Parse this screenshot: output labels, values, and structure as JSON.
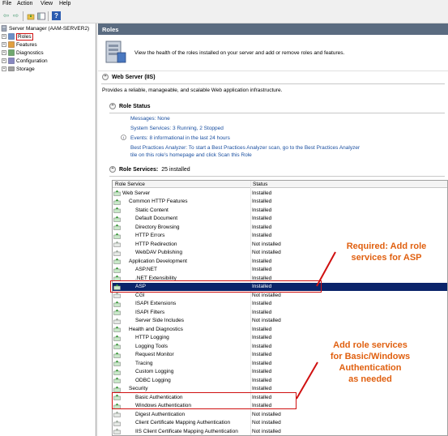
{
  "menu": {
    "file": "File",
    "action": "Action",
    "view": "View",
    "help": "Help"
  },
  "toolbar": {
    "back_glyph": "⇦",
    "forward_glyph": "⇨",
    "help_glyph": "?"
  },
  "tree": {
    "root": "Server Manager (AAM-SERVER2)",
    "items": [
      {
        "label": "Roles"
      },
      {
        "label": "Features"
      },
      {
        "label": "Diagnostics"
      },
      {
        "label": "Configuration"
      },
      {
        "label": "Storage"
      }
    ]
  },
  "panel": {
    "title": "Roles",
    "description": "View the health of the roles installed on your server and add or remove roles and features."
  },
  "web_server": {
    "header": "Web Server (IIS)",
    "description": "Provides a reliable, manageable, and scalable Web application infrastructure.",
    "role_status": {
      "header": "Role Status",
      "messages": "Messages: None",
      "system_services": "System Services: 3 Running, 2 Stopped",
      "events": "Events: 8 informational in the last 24 hours",
      "bpa_line1": "Best Practices Analyzer: To start a Best Practices Analyzer scan, go to the Best Practices Analyzer",
      "bpa_line2": "tile on this role's homepage and click Scan this Role"
    },
    "role_services": {
      "header": "Role Services:",
      "count": "25 installed",
      "col_role_service": "Role Service",
      "col_status": "Status",
      "rows": [
        {
          "name": "Web Server",
          "status": "Installed"
        },
        {
          "name": "Common HTTP Features",
          "status": "Installed"
        },
        {
          "name": "Static Content",
          "status": "Installed"
        },
        {
          "name": "Default Document",
          "status": "Installed"
        },
        {
          "name": "Directory Browsing",
          "status": "Installed"
        },
        {
          "name": "HTTP Errors",
          "status": "Installed"
        },
        {
          "name": "HTTP Redirection",
          "status": "Not installed"
        },
        {
          "name": "WebDAV Publishing",
          "status": "Not installed"
        },
        {
          "name": "Application Development",
          "status": "Installed"
        },
        {
          "name": "ASP.NET",
          "status": "Installed"
        },
        {
          "name": ".NET Extensibility",
          "status": "Installed"
        },
        {
          "name": "ASP",
          "status": "Installed"
        },
        {
          "name": "CGI",
          "status": "Not installed"
        },
        {
          "name": "ISAPI Extensions",
          "status": "Installed"
        },
        {
          "name": "ISAPI Filters",
          "status": "Installed"
        },
        {
          "name": "Server Side Includes",
          "status": "Not installed"
        },
        {
          "name": "Health and Diagnostics",
          "status": "Installed"
        },
        {
          "name": "HTTP Logging",
          "status": "Installed"
        },
        {
          "name": "Logging Tools",
          "status": "Installed"
        },
        {
          "name": "Request Monitor",
          "status": "Installed"
        },
        {
          "name": "Tracing",
          "status": "Installed"
        },
        {
          "name": "Custom Logging",
          "status": "Installed"
        },
        {
          "name": "ODBC Logging",
          "status": "Installed"
        },
        {
          "name": "Security",
          "status": "Installed"
        },
        {
          "name": "Basic Authentication",
          "status": "Installed"
        },
        {
          "name": "Windows Authentication",
          "status": "Installed"
        },
        {
          "name": "Digest Authentication",
          "status": "Not installed"
        },
        {
          "name": "Client Certificate Mapping Authentication",
          "status": "Not installed"
        },
        {
          "name": "IIS Client Certificate Mapping Authentication",
          "status": "Not installed"
        }
      ]
    }
  },
  "annotations": {
    "asp_line1": "Required: Add role",
    "asp_line2": "services for ASP",
    "auth_line1": "Add role services",
    "auth_line2": "for Basic/Windows",
    "auth_line3": "Authentication",
    "auth_line4": "as needed"
  },
  "colors": {
    "selected_row": "#0a246a",
    "callout_text": "#e06010",
    "highlight_border": "#d01010",
    "link": "#1a4fa0"
  }
}
